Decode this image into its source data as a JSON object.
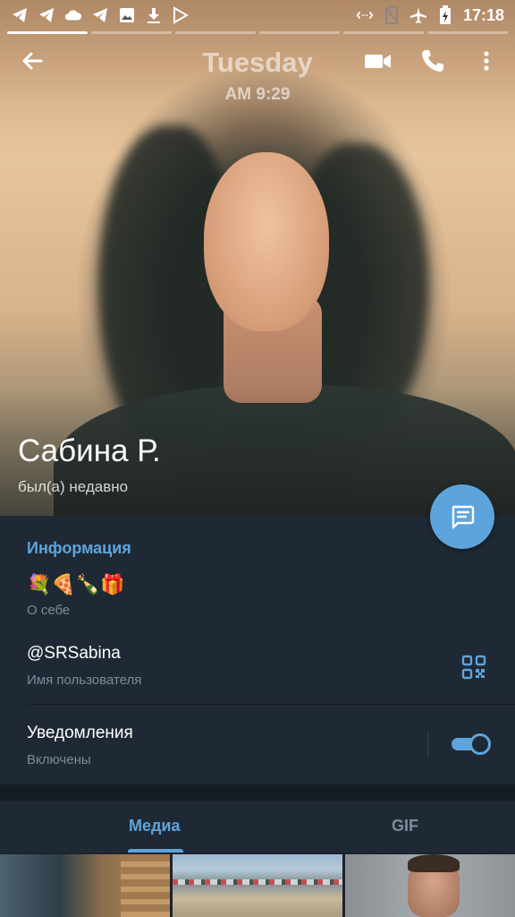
{
  "status_bar": {
    "time": "17:18",
    "left_icons": [
      "telegram-icon",
      "telegram-icon",
      "cloud-icon",
      "telegram-icon",
      "image-icon",
      "download-icon",
      "play-store-icon"
    ],
    "right_icons": [
      "nfc-icon",
      "no-sim-icon",
      "airplane-icon",
      "battery-icon"
    ]
  },
  "photo": {
    "day": "Tuesday",
    "time": "AM 9:29",
    "story_bars_total": 6,
    "story_bars_active": 1
  },
  "profile": {
    "name": "Сабина Р.",
    "status": "был(а) недавно"
  },
  "info": {
    "section_title": "Информация",
    "bio": "💐🍕🍾🎁",
    "bio_label": "О себе",
    "username": "@SRSabina",
    "username_label": "Имя пользователя",
    "notifications": "Уведомления",
    "notifications_status": "Включены",
    "notifications_enabled": true
  },
  "tabs": [
    {
      "label": "Медиа",
      "active": true
    },
    {
      "label": "GIF",
      "active": false
    }
  ],
  "colors": {
    "accent": "#5ea4dc",
    "background": "#1f2935",
    "secondary_text": "#7d8b99"
  }
}
